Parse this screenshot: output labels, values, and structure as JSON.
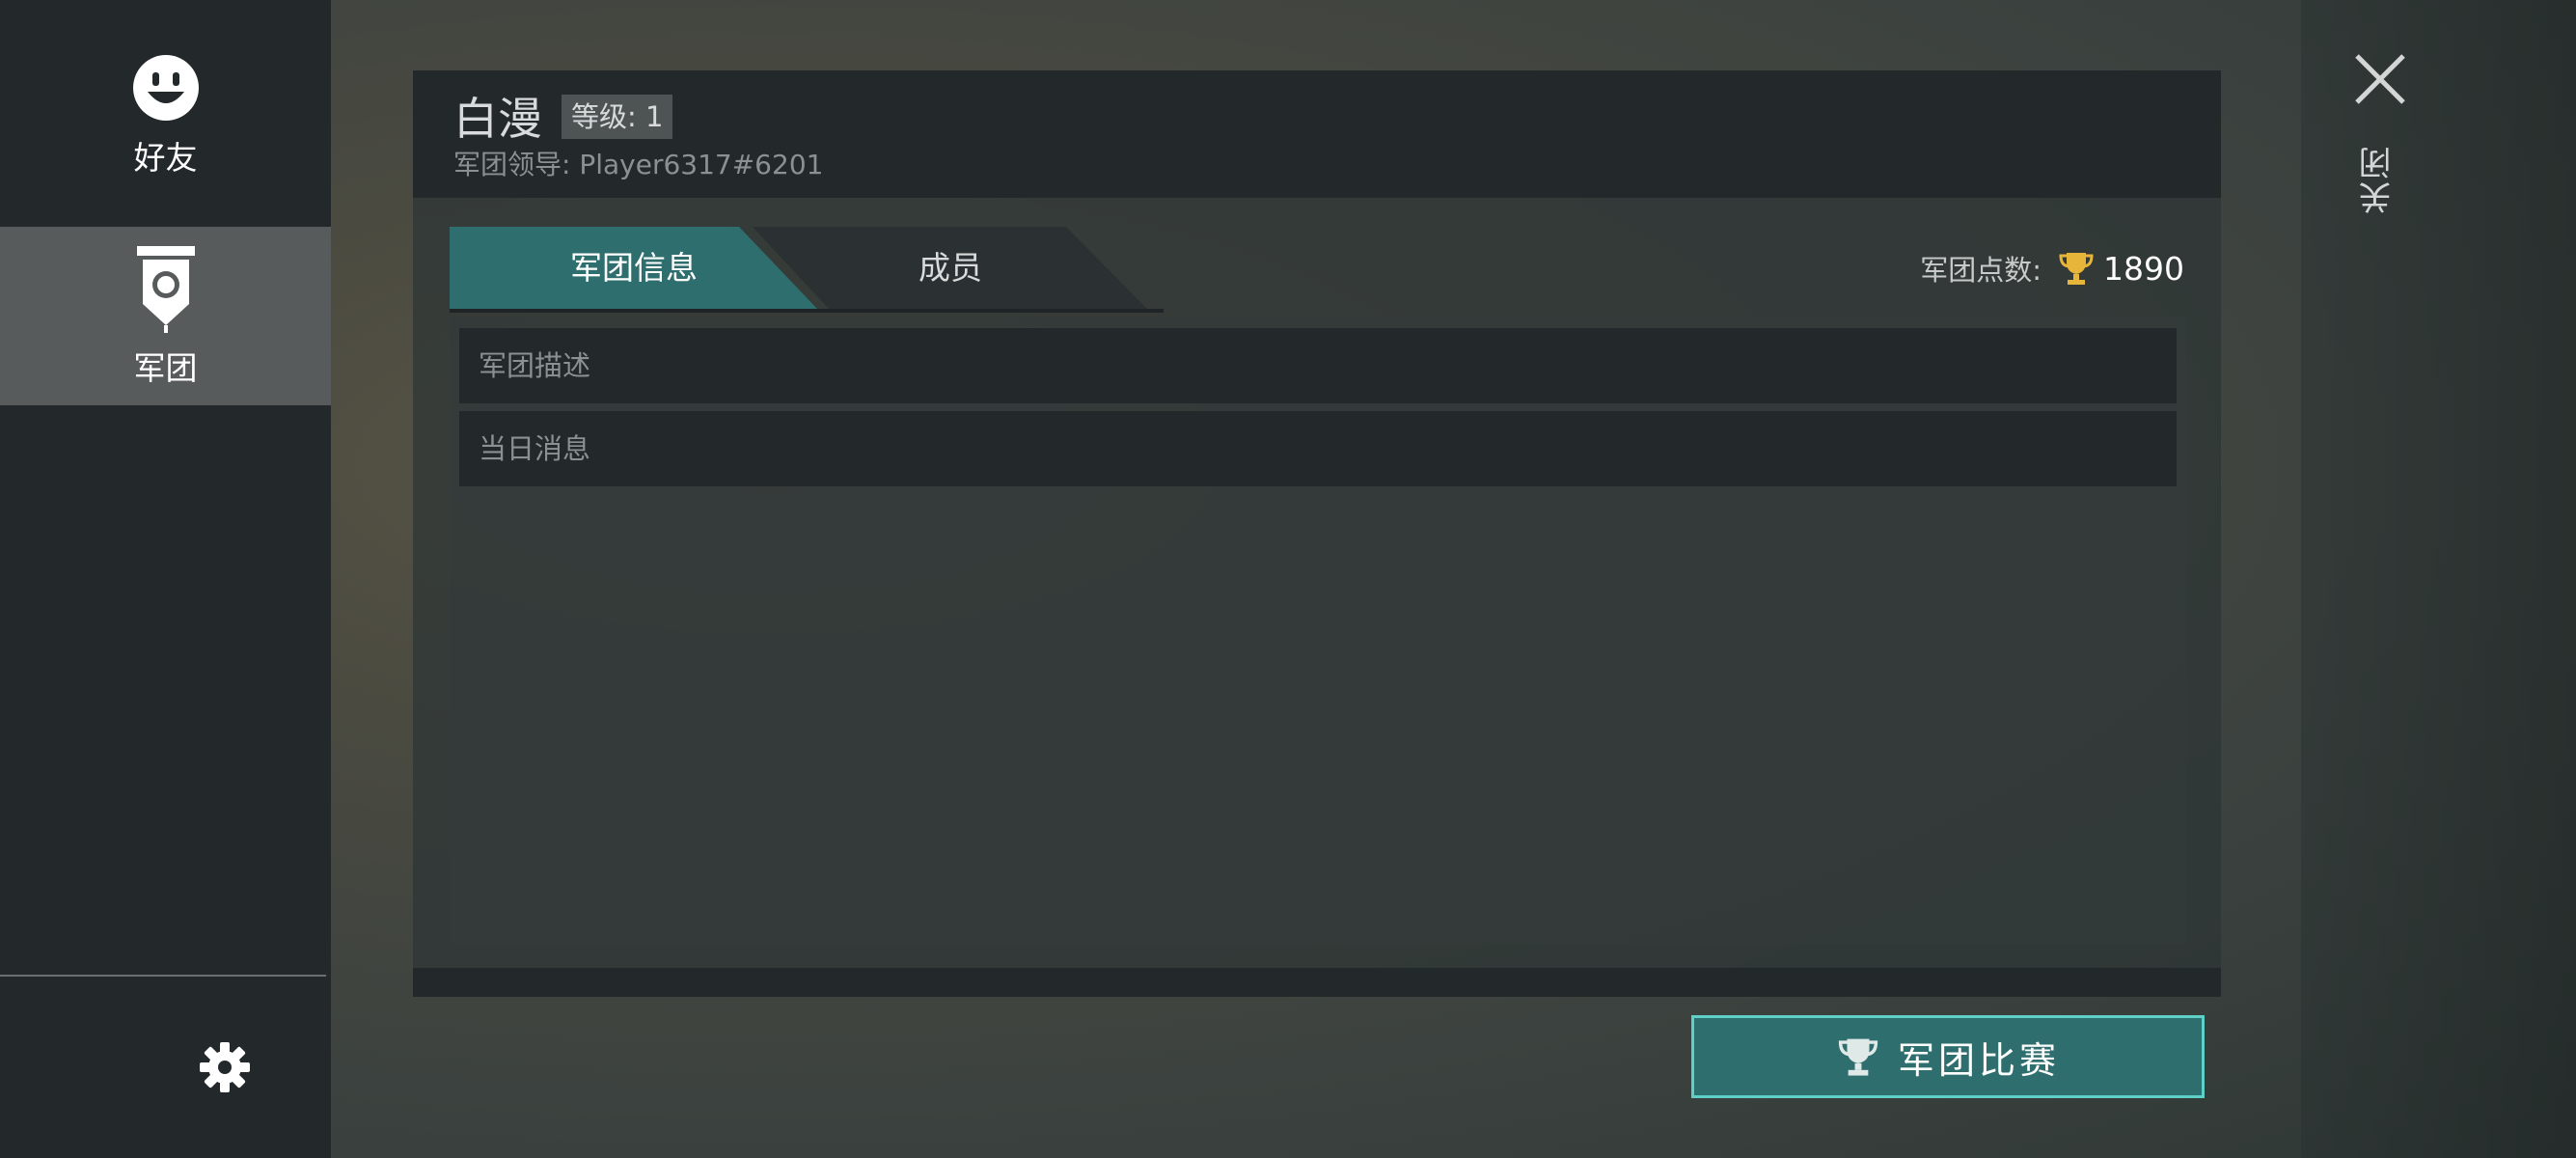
{
  "sidebar": {
    "items": [
      {
        "label": "好友",
        "icon": "smiley-icon"
      },
      {
        "label": "军团",
        "icon": "banner-icon"
      }
    ],
    "settings_icon": "gear-icon"
  },
  "close": {
    "label": "关闭",
    "icon": "close-icon"
  },
  "legion": {
    "name": "白漫",
    "level": "等级: 1",
    "leader": "军团领导: Player6317#6201"
  },
  "tabs": [
    {
      "label": "军团信息",
      "active": true
    },
    {
      "label": "成员",
      "active": false
    }
  ],
  "points": {
    "label": "军团点数:",
    "value": "1890",
    "icon": "trophy-icon"
  },
  "content": {
    "rows": [
      {
        "label": "军团描述"
      },
      {
        "label": "当日消息"
      }
    ]
  },
  "match_button": {
    "label": "军团比赛",
    "icon": "trophy-icon"
  },
  "colors": {
    "accent": "#2f6e6e",
    "accent_border": "#5fd0c8",
    "trophy": "#e7b53a",
    "panel_dark": "#23282b"
  }
}
